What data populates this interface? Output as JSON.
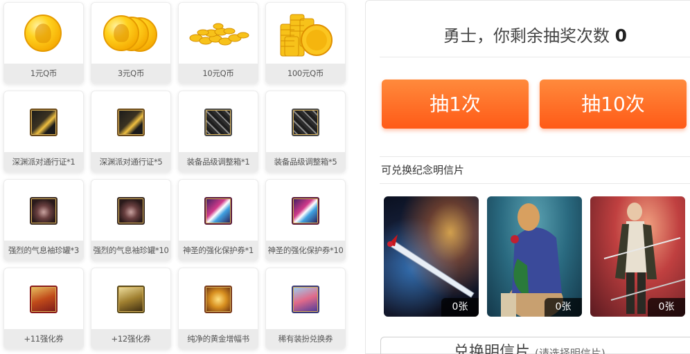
{
  "prizes": [
    {
      "label": "1元Q币",
      "icon": "one-coin-icon"
    },
    {
      "label": "3元Q币",
      "icon": "three-coins-icon"
    },
    {
      "label": "10元Q币",
      "icon": "coin-pile-icon"
    },
    {
      "label": "100元Q币",
      "icon": "coin-stack-icon"
    },
    {
      "label": "深渊派对通行证*1",
      "icon": "abyss-pass-icon"
    },
    {
      "label": "深渊派对通行证*5",
      "icon": "abyss-pass-icon"
    },
    {
      "label": "装备品级调整箱*1",
      "icon": "equipment-box-icon"
    },
    {
      "label": "装备品级调整箱*5",
      "icon": "equipment-box-icon"
    },
    {
      "label": "强烈的气息袖珍罐*3",
      "icon": "aura-jar-icon"
    },
    {
      "label": "强烈的气息袖珍罐*10",
      "icon": "aura-jar-icon"
    },
    {
      "label": "神圣的强化保护券*1",
      "icon": "protection-ticket-icon"
    },
    {
      "label": "神圣的强化保护券*10",
      "icon": "protection-ticket-icon"
    },
    {
      "label": "+11强化券",
      "icon": "plus11-ticket-icon"
    },
    {
      "label": "+12强化券",
      "icon": "plus12-ticket-icon"
    },
    {
      "label": "纯净的黄金增幅书",
      "icon": "golden-book-icon"
    },
    {
      "label": "稀有装扮兑换券",
      "icon": "avatar-ticket-icon"
    }
  ],
  "draw": {
    "title_prefix": "勇士，你剩余抽奖次数",
    "remaining": "0",
    "draw_once": "抽1次",
    "draw_ten": "抽10次"
  },
  "postcards": {
    "heading": "可兑换纪念明信片",
    "items": [
      {
        "count": "0张",
        "icon": "nebula-sword-card"
      },
      {
        "count": "0张",
        "icon": "hooded-figure-card"
      },
      {
        "count": "0张",
        "icon": "swordsman-card"
      }
    ],
    "exchange_label": "兑换明信片",
    "exchange_hint": "(请选择明信片)"
  },
  "colors": {
    "accent": "#ff5a17",
    "accent_light": "#ff8a3c",
    "label_bg": "#ebebeb"
  }
}
